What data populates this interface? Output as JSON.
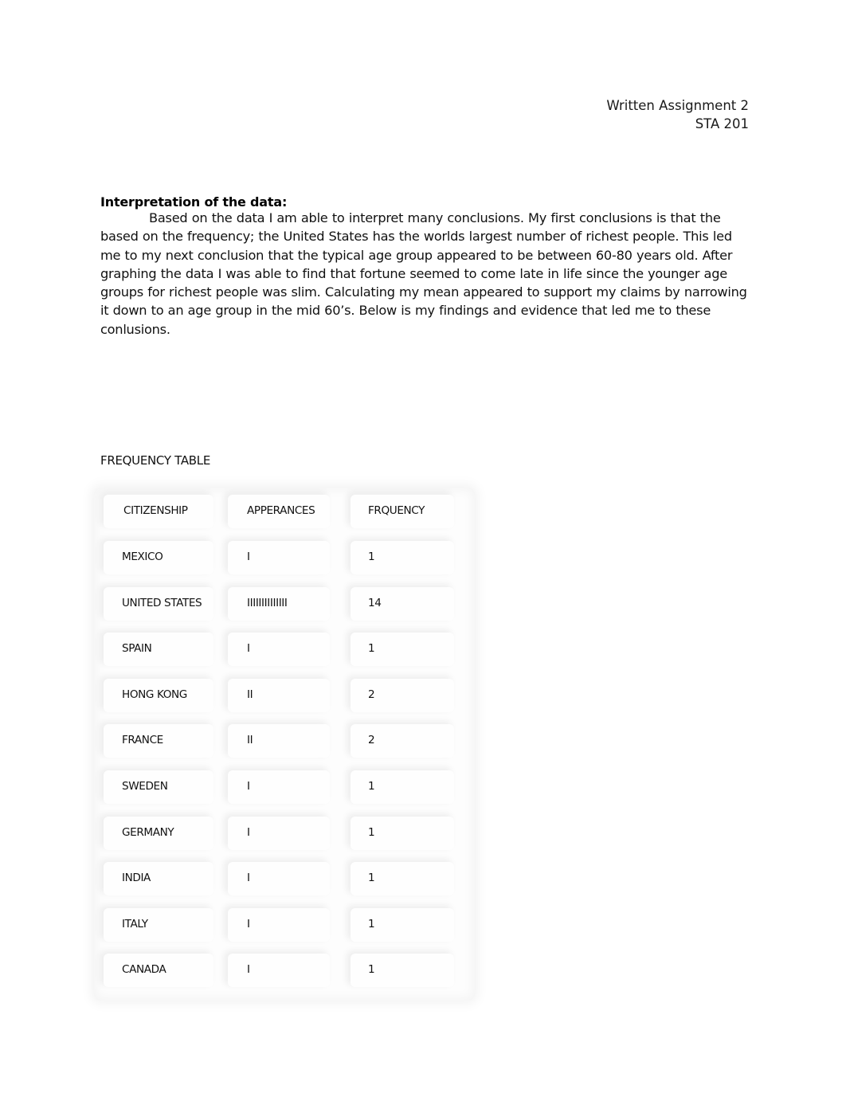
{
  "header": {
    "assignment": "Written Assignment 2",
    "course": "STA 201"
  },
  "section": {
    "heading": "Interpretation of the data:",
    "paragraph": "Based on the data I am able to interpret many conclusions.  My first conclusions is that the based on the frequency; the United States has the worlds largest number of richest people.  This led me to my next conclusion that the typical age group appeared to be between 60-80 years old.  After graphing the data I was able to find that fortune seemed to come late in life since the younger age groups for richest people was slim.  Calculating my mean appeared to support my claims by narrowing it down to an age group in the mid 60’s. Below is my findings and evidence that led me to these conlusions."
  },
  "frequency_table": {
    "title": "FREQUENCY TABLE",
    "columns": [
      "CITIZENSHIP",
      "APPERANCES",
      "FRQUENCY"
    ],
    "rows": [
      {
        "citizenship": "MEXICO",
        "appearances": "I",
        "frequency": "1"
      },
      {
        "citizenship": "UNITED STATES",
        "appearances": "IIIIIIIIIIIIII",
        "frequency": "14"
      },
      {
        "citizenship": "SPAIN",
        "appearances": "I",
        "frequency": "1"
      },
      {
        "citizenship": "HONG KONG",
        "appearances": "II",
        "frequency": "2"
      },
      {
        "citizenship": "FRANCE",
        "appearances": "II",
        "frequency": "2"
      },
      {
        "citizenship": "SWEDEN",
        "appearances": "I",
        "frequency": "1"
      },
      {
        "citizenship": "GERMANY",
        "appearances": "I",
        "frequency": "1"
      },
      {
        "citizenship": "INDIA",
        "appearances": "I",
        "frequency": "1"
      },
      {
        "citizenship": "ITALY",
        "appearances": "I",
        "frequency": "1"
      },
      {
        "citizenship": "CANADA",
        "appearances": "I",
        "frequency": "1"
      }
    ]
  }
}
